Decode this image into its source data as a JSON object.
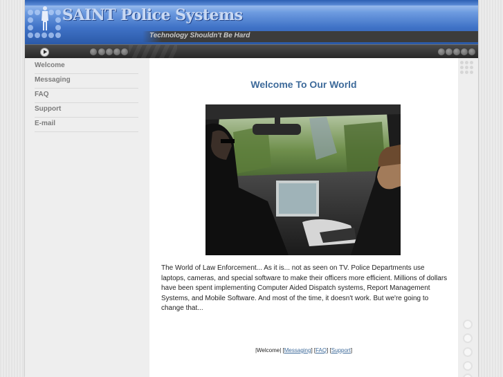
{
  "header": {
    "title": "SAINT Police Systems",
    "tagline": "Technology Shouldn't Be Hard",
    "logo_icon": "police-officer-figure"
  },
  "toolbar": {
    "play_icon": "play-icon"
  },
  "sidebar": {
    "items": [
      {
        "label": "Welcome"
      },
      {
        "label": "Messaging"
      },
      {
        "label": "FAQ"
      },
      {
        "label": "Support"
      },
      {
        "label": "E-mail"
      }
    ]
  },
  "main": {
    "title": "Welcome To Our World",
    "body": "The World of Law Enforcement... As it is... not as seen on TV. Police Departments use laptops, cameras, and special software to make their officers more efficient. Millions of dollars have been spent implementing Computer Aided Dispatch systems, Report Management Systems, and Mobile Software. And most of the time, it doesn't work. But we're going to change that..."
  },
  "footer": {
    "welcome": "Welcome",
    "messaging": "Messaging",
    "faq": "FAQ",
    "support": "Support"
  },
  "colors": {
    "header_blue": "#3f72c6",
    "title_blue": "#3d6a9a",
    "nav_gray": "#7b7b7b"
  }
}
